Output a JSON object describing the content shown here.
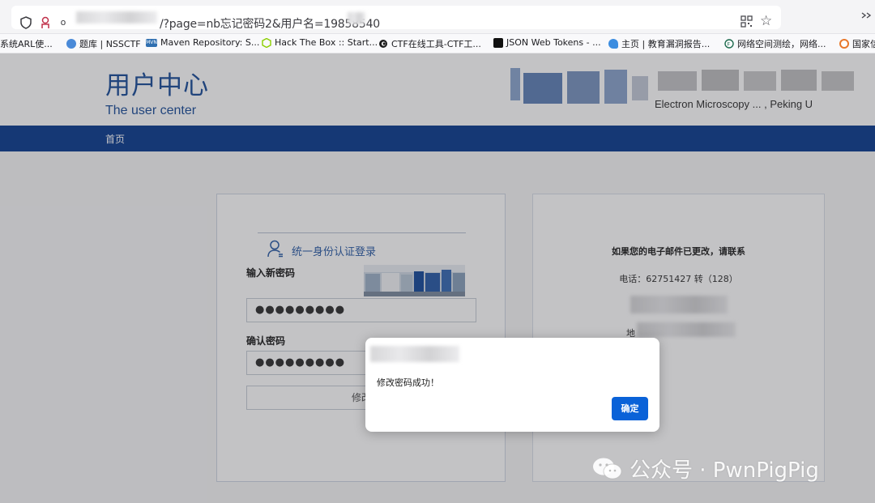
{
  "browser": {
    "url_visible": "/?page=nb忘记密码2&用户名=19858540"
  },
  "bookmarks": [
    {
      "label": "系统ARL使...",
      "icon": "none",
      "color": ""
    },
    {
      "label": "题库 | NSSCTF",
      "icon": "nssctf-icon",
      "color": "#4a8ad8"
    },
    {
      "label": "Maven Repository: S...",
      "icon": "mvn-icon",
      "color": "#2f6fb0"
    },
    {
      "label": "Hack The Box :: Start...",
      "icon": "htb-icon",
      "color": "#9fef00"
    },
    {
      "label": "CTF在线工具-CTF工...",
      "icon": "ctf-tool-icon",
      "color": "#1b1b1b"
    },
    {
      "label": "JSON Web Tokens - ...",
      "icon": "jwt-icon",
      "color": "#111111"
    },
    {
      "label": "主页 | 教育漏洞报告...",
      "icon": "edu-vuln-icon",
      "color": "#3c8de0"
    },
    {
      "label": "网络空间测绘，网络...",
      "icon": "fofa-icon",
      "color": "#1e6b4e"
    },
    {
      "label": "国家信",
      "icon": "gov-icon",
      "color": "#e8782b"
    }
  ],
  "site": {
    "title": "用户中心",
    "subtitle": "The user center",
    "logo_subtext": "Electron Microscopy ... , Peking U",
    "nav_home": "首页"
  },
  "login": {
    "auth_link": "统一身份认证登录",
    "new_password_label": "输入新密码",
    "new_password_value": "●●●●●●●●●",
    "confirm_label": "确认密码",
    "confirm_value": "●●●●●●●●●",
    "submit_label": "修改"
  },
  "info": {
    "heading": "如果您的电子邮件已更改，请联系",
    "phone": "电话：62751427 转（128）",
    "address_prefix": "地"
  },
  "dialog": {
    "message": "修改密码成功！",
    "ok_label": "确定"
  },
  "watermark": {
    "text": "公众号 · PwnPigPig"
  },
  "colors": {
    "brand_blue": "#1e4f9a",
    "nav_bar": "#0e3f91",
    "ok_button": "#0a62d8"
  }
}
